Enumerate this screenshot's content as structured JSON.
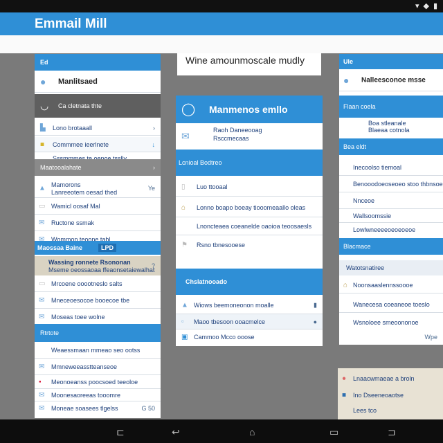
{
  "app": {
    "title": "Emmail Mill"
  },
  "top_note": "Wine amounmoscale mudly",
  "left_panel": {
    "tag": "Ed",
    "account": "Manlitsaed",
    "folder_label": "Ca cletnata thte",
    "compose_line": "Lono brotaaall",
    "compose_sub": "Commmee ieerlnete",
    "compose_sub2": "Sssmmmes te oenoe tsslly",
    "section1": "Maatooalahate",
    "items1": [
      {
        "text": "Mamorons",
        "sub": "Lanreeotem oesad thed",
        "meta": "Ye"
      },
      {
        "text": "Wamicl oosaf Mal",
        "sub": ""
      },
      {
        "text": "Ructone ssmak",
        "sub": ""
      },
      {
        "text": "Wommon teoone tabl",
        "sub": ""
      }
    ],
    "highlight_title": "Maossaa Baine",
    "highlight_badge": "LPD",
    "highlight_row": "Wassing ronnete Rsononan",
    "highlight_sub": "Mseme oeossaoaa ffeaonsetaiewalhat",
    "highlight_meta": "?",
    "items2": [
      "Mrcoene ooootneslo salts",
      "Mneceoesocoe booecoe tbe",
      "Moseas toee wolne"
    ],
    "section2": "Rtrtote",
    "items3": [
      "Weaessmaan mmeao seo ootss",
      "Mmneweeasstteanseoe",
      "Meonoeanss poocsoed teeoloe",
      "Moonesaoreeas tooomre",
      "Moneae soasees tlgelss"
    ],
    "footer_meta": "G 50"
  },
  "center_panel": {
    "title": "Manmenos emllo",
    "info1": "Raoh Daneeooag",
    "info2": "Rsccmecaas",
    "section1": "Lcnioal Bodtreo",
    "rows": [
      "Luo ttooaal",
      "Lonno boapo boeay tiooomeaallo oleas",
      "Lnoncteaea coeanelde oaoioa teoosaesls",
      "Rsno tbnesooese"
    ],
    "section2": "Chslatnooado",
    "actions": [
      "Wiows beemoneonon moalle",
      "Maoo tbesoon ooacmelce",
      "Cammoo Mcco ooose"
    ]
  },
  "right_panel": {
    "tag": "Ule",
    "account": "Nalleesconoe msse",
    "section1": "Flaan coela",
    "info1": "Boa stleanale",
    "info2": "Blaeaa cotnola",
    "section2": "Bea eldt",
    "rows": [
      "Inecoolso tiemoal",
      "Benooodoeoseoeo stoo thbnsoe",
      "Nnceoe",
      "Wallsoomssie",
      "Lowlwneeeeoeoeoeoe"
    ],
    "section3": "Blacmace",
    "section4": "Watotsnatiree",
    "items": [
      "Noonsaaslennssoooe",
      "Wanecesa coeaneoe toeslo",
      "Wsnoloee smeoononoe"
    ],
    "footer_meta": "Wpe"
  },
  "bottom_card": {
    "rows": [
      "Lnaacwmaeae a broln",
      "Ino Dseeneoaotse",
      "Lees tco"
    ]
  },
  "colors": {
    "accent": "#2f8fd6",
    "panel_grey": "#5f5f5f",
    "background": "#7a7a7a"
  }
}
